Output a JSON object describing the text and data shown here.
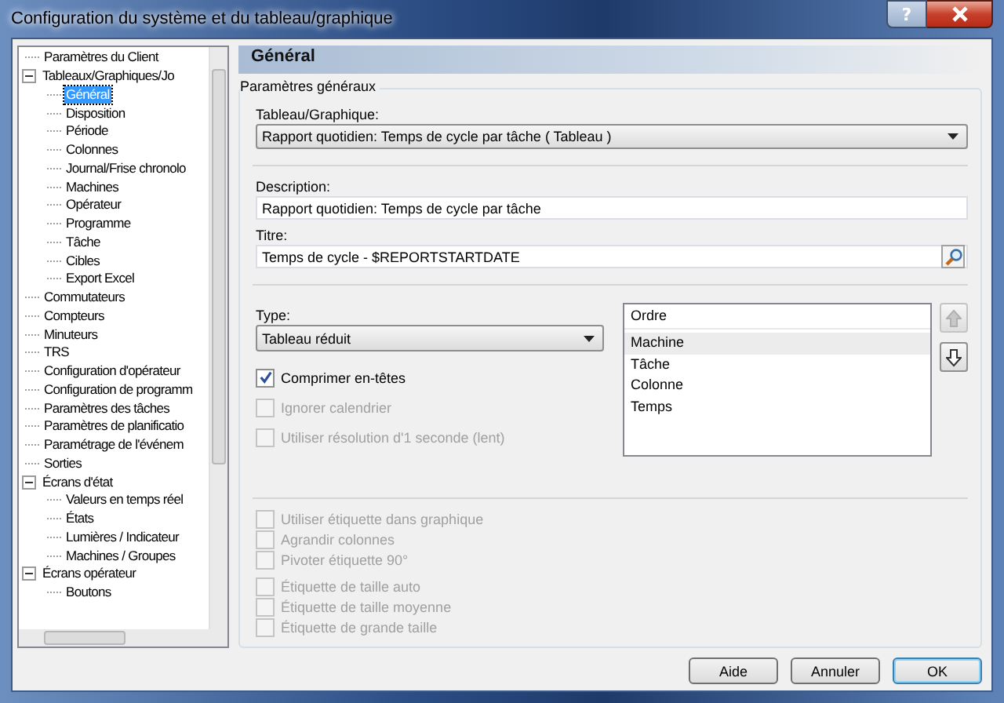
{
  "window": {
    "title": "Configuration du système et du tableau/graphique",
    "help_button": "?"
  },
  "tree": {
    "items": [
      {
        "label": "Paramètres du Client",
        "selected": false
      },
      {
        "label": "Tableaux/Graphiques/Jo",
        "selected": false,
        "expanded": true,
        "children": [
          {
            "label": "Général",
            "selected": true
          },
          {
            "label": "Disposition",
            "selected": false
          },
          {
            "label": "Période",
            "selected": false
          },
          {
            "label": "Colonnes",
            "selected": false
          },
          {
            "label": "Journal/Frise chronolo",
            "selected": false
          },
          {
            "label": "Machines",
            "selected": false
          },
          {
            "label": "Opérateur",
            "selected": false
          },
          {
            "label": "Programme",
            "selected": false
          },
          {
            "label": "Tâche",
            "selected": false
          },
          {
            "label": "Cibles",
            "selected": false
          },
          {
            "label": "Export Excel",
            "selected": false
          }
        ]
      },
      {
        "label": "Commutateurs",
        "selected": false
      },
      {
        "label": "Compteurs",
        "selected": false
      },
      {
        "label": "Minuteurs",
        "selected": false
      },
      {
        "label": "TRS",
        "selected": false
      },
      {
        "label": "Configuration d'opérateur",
        "selected": false
      },
      {
        "label": "Configuration de programm",
        "selected": false
      },
      {
        "label": "Paramètres des tâches",
        "selected": false
      },
      {
        "label": "Paramètres de planificatio",
        "selected": false
      },
      {
        "label": "Paramétrage de l'événem",
        "selected": false
      },
      {
        "label": "Sorties",
        "selected": false
      },
      {
        "label": "Écrans d'état",
        "selected": false,
        "expanded": true,
        "children": [
          {
            "label": "Valeurs en temps réel",
            "selected": false
          },
          {
            "label": "États",
            "selected": false
          },
          {
            "label": "Lumières / Indicateur",
            "selected": false
          },
          {
            "label": "Machines / Groupes",
            "selected": false
          }
        ]
      },
      {
        "label": "Écrans opérateur",
        "selected": false,
        "expanded": true,
        "children": [
          {
            "label": "Boutons",
            "selected": false
          }
        ]
      }
    ]
  },
  "header": "Général",
  "group": {
    "legend": "Paramètres généraux",
    "chart_label": "Tableau/Graphique:",
    "chart_value": "Rapport quotidien: Temps de cycle par tâche  ( Tableau )",
    "description_label": "Description:",
    "description_value": "Rapport quotidien: Temps de cycle par tâche",
    "title_label": "Titre:",
    "title_value": "Temps de cycle - $REPORTSTARTDATE",
    "type_label": "Type:",
    "type_value": "Tableau réduit",
    "options": [
      {
        "label": "Comprimer en-têtes",
        "checked": true,
        "disabled": false
      },
      {
        "label": "Ignorer calendrier",
        "checked": false,
        "disabled": true
      },
      {
        "label": "Utiliser résolution d'1 seconde (lent)",
        "checked": false,
        "disabled": true
      }
    ],
    "order": {
      "header": "Ordre",
      "items": [
        {
          "label": "Machine",
          "selected": true
        },
        {
          "label": "Tâche",
          "selected": false
        },
        {
          "label": "Colonne",
          "selected": false
        },
        {
          "label": "Temps",
          "selected": false
        }
      ],
      "up_disabled": true,
      "down_disabled": false
    },
    "label_options": [
      {
        "label": "Utiliser étiquette dans graphique",
        "checked": false,
        "disabled": true
      },
      {
        "label": "Agrandir colonnes",
        "checked": false,
        "disabled": true
      },
      {
        "label": "Pivoter étiquette 90°",
        "checked": false,
        "disabled": true
      }
    ],
    "size_options": [
      {
        "label": "Étiquette de taille auto",
        "checked": false,
        "disabled": true
      },
      {
        "label": "Étiquette de taille moyenne",
        "checked": false,
        "disabled": true
      },
      {
        "label": "Étiquette de grande taille",
        "checked": false,
        "disabled": true
      }
    ]
  },
  "buttons": [
    {
      "label": "Aide",
      "default": false
    },
    {
      "label": "Annuler",
      "default": false
    },
    {
      "label": "OK",
      "default": true
    }
  ]
}
